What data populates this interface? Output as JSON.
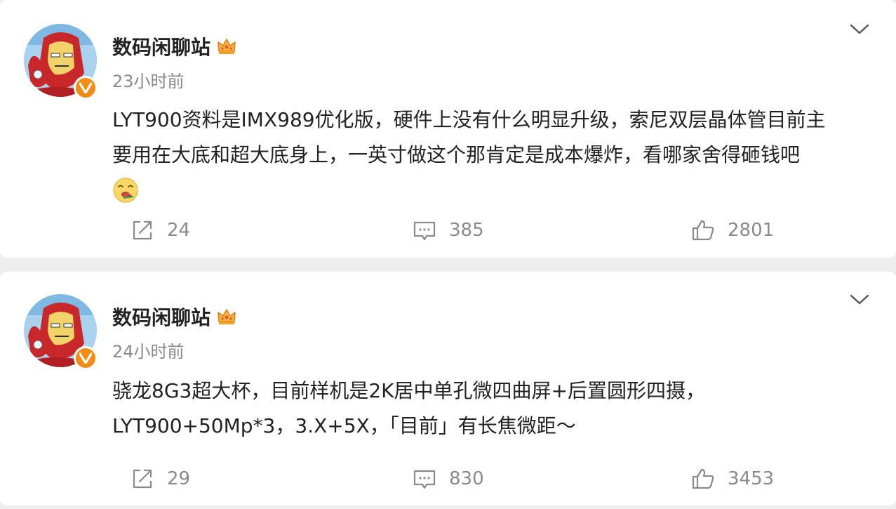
{
  "posts": [
    {
      "author": "数码闲聊站",
      "time": "23小时前",
      "lines": [
        "LYT900资料是IMX989优化版，硬件上没有什么明显升级，索尼双层晶体管目前主",
        "要用在大底和超大底身上，一英寸做这个那肯定是成本爆炸，看哪家舍得砸钱吧"
      ],
      "emoji": "eating-emoji",
      "share_count": "24",
      "comment_count": "385",
      "like_count": "2801"
    },
    {
      "author": "数码闲聊站",
      "time": "24小时前",
      "lines": [
        "骁龙8G3超大杯，目前样机是2K居中单孔微四曲屏+后置圆形四摄，",
        "LYT900+50Mp*3，3.X+5X，「目前」有长焦微距～"
      ],
      "share_count": "29",
      "comment_count": "830",
      "like_count": "3453"
    }
  ],
  "colors": {
    "background": "#eeeeee",
    "card": "#ffffff",
    "text": "#222222",
    "muted": "#8a8a8a",
    "verified_badge": "#f28c15"
  },
  "icons": [
    "ironman-avatar",
    "verified-v-icon",
    "crown-icon",
    "chevron-down-icon",
    "share-icon",
    "comment-icon",
    "like-icon"
  ]
}
